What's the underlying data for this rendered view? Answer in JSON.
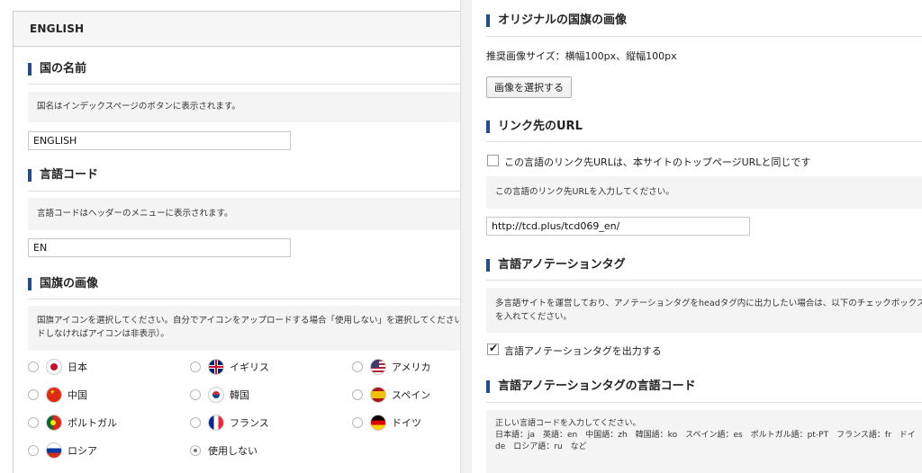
{
  "left": {
    "tab_label": "ENGLISH",
    "country_name": {
      "heading": "国の名前",
      "note": "国名はインデックスページのボタンに表示されます。",
      "value": "ENGLISH"
    },
    "language_code": {
      "heading": "言語コード",
      "note": "言語コードはヘッダーのメニューに表示されます。",
      "value": "EN"
    },
    "flag_image": {
      "heading": "国旗の画像",
      "note_line1": "国旗アイコンを選択してください。自分でアイコンをアップロードする場合「使用しない」を選択してください（ア",
      "note_line2": "ドしなければアイコンは非表示）。",
      "options": [
        {
          "label": "日本",
          "flag": "japan-flag-icon"
        },
        {
          "label": "イギリス",
          "flag": "uk-flag-icon"
        },
        {
          "label": "アメリカ",
          "flag": "usa-flag-icon"
        },
        {
          "label": "中国",
          "flag": "china-flag-icon"
        },
        {
          "label": "韓国",
          "flag": "korea-flag-icon"
        },
        {
          "label": "スペイン",
          "flag": "spain-flag-icon"
        },
        {
          "label": "ポルトガル",
          "flag": "portugal-flag-icon"
        },
        {
          "label": "フランス",
          "flag": "france-flag-icon"
        },
        {
          "label": "ドイツ",
          "flag": "germany-flag-icon"
        },
        {
          "label": "ロシア",
          "flag": "russia-flag-icon"
        },
        {
          "label": "使用しない",
          "flag": ""
        }
      ],
      "selected": "使用しない"
    }
  },
  "right": {
    "original_flag": {
      "heading": "オリジナルの国旗の画像",
      "size_text": "推奨画像サイズ：横幅100px、縦幅100px",
      "button_label": "画像を選択する"
    },
    "link_url": {
      "heading": "リンク先のURL",
      "checkbox_label": "この言語のリンク先URLは、本サイトのトップページURLと同じです",
      "checkbox_checked": false,
      "note": "この言語のリンク先URLを入力してください。",
      "value": "http://tcd.plus/tcd069_en/"
    },
    "annotation_tag": {
      "heading": "言語アノテーションタグ",
      "note_line1": "多言語サイトを運営しており、アノテーションタグをheadタグ内に出力したい場合は、以下のチェックボックスにチ",
      "note_line2": "を入れてください。",
      "checkbox_label": "言語アノテーションタグを出力する",
      "checkbox_checked": true
    },
    "annotation_code": {
      "heading": "言語アノテーションタグの言語コード",
      "note_line1": "正しい言語コードを入力してください。",
      "note_line2": "日本語：ja　英語：en　中国語：zh　韓国語：ko　スペイン語：es　ポルトガル語：pt-PT　フランス語：fr　ドイ",
      "note_line3": "de　ロシア語：ru　など"
    }
  },
  "colors": {
    "heading_accent": "#1f4e8c",
    "note_bg": "#f4f4f4"
  }
}
